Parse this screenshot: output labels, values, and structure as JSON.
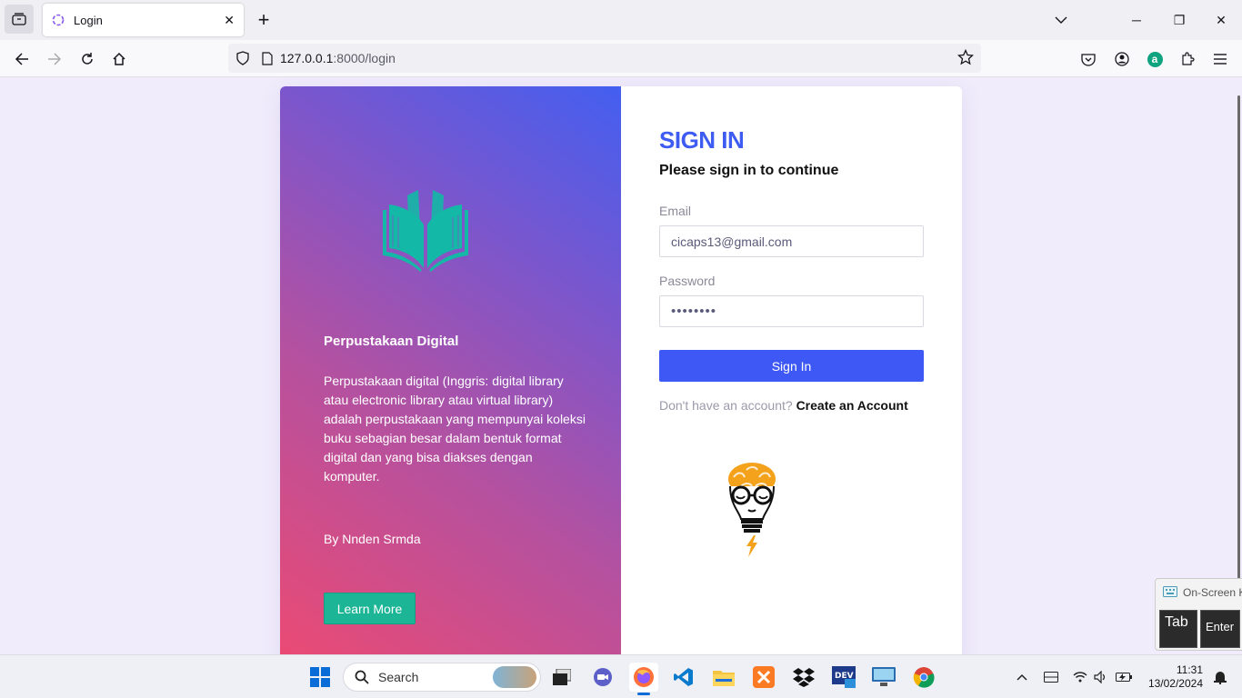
{
  "browser": {
    "tab_title": "Login",
    "url_host": "127.0.0.1",
    "url_path": ":8000/login"
  },
  "left_panel": {
    "title": "Perpustakaan Digital",
    "description": "Perpustakaan digital (Inggris: digital library atau electronic library atau virtual library) adalah perpustakaan yang mempunyai koleksi buku sebagian besar dalam bentuk format digital dan yang bisa diakses dengan komputer.",
    "author": "By Nnden Srmda",
    "learn_more_label": "Learn More"
  },
  "login_form": {
    "title": "SIGN IN",
    "subtitle": "Please sign in to continue",
    "email_label": "Email",
    "email_value": "cicaps13@gmail.com",
    "password_label": "Password",
    "password_value": "••••••••",
    "submit_label": "Sign In",
    "no_account_text": "Don't have an account?",
    "create_account_label": "Create an Account"
  },
  "taskbar": {
    "search_label": "Search",
    "time": "11:31",
    "date": "13/02/2024"
  },
  "osk": {
    "title": "On-Screen K",
    "tab_key": "Tab",
    "enter_key": "Enter"
  },
  "colors": {
    "accent": "#3d58f5",
    "teal": "#1cb596",
    "title_blue": "#3e5bf2"
  }
}
